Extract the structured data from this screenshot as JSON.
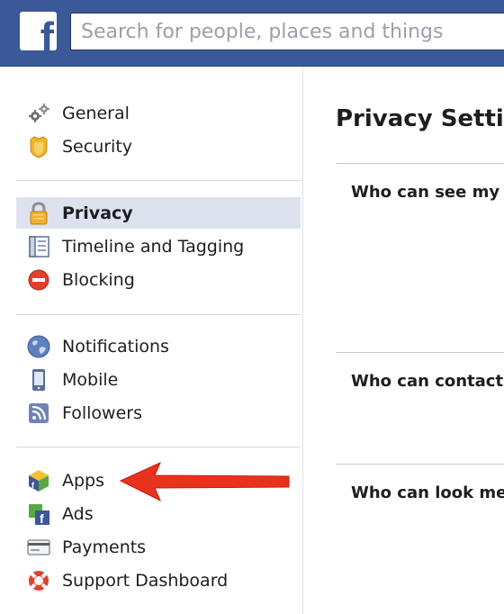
{
  "header": {
    "logo_letter": "f",
    "search_placeholder": "Search for people, places and things"
  },
  "sidebar": {
    "groups": [
      [
        {
          "label": "General",
          "icon": "gears-icon"
        },
        {
          "label": "Security",
          "icon": "security-badge-icon"
        }
      ],
      [
        {
          "label": "Privacy",
          "icon": "lock-icon",
          "active": true
        },
        {
          "label": "Timeline and Tagging",
          "icon": "timeline-icon"
        },
        {
          "label": "Blocking",
          "icon": "blocking-icon"
        }
      ],
      [
        {
          "label": "Notifications",
          "icon": "globe-icon"
        },
        {
          "label": "Mobile",
          "icon": "mobile-phone-icon"
        },
        {
          "label": "Followers",
          "icon": "rss-icon"
        }
      ],
      [
        {
          "label": "Apps",
          "icon": "apps-cube-icon"
        },
        {
          "label": "Ads",
          "icon": "ads-icon"
        },
        {
          "label": "Payments",
          "icon": "credit-card-icon"
        },
        {
          "label": "Support Dashboard",
          "icon": "lifebuoy-icon"
        }
      ]
    ]
  },
  "main": {
    "title": "Privacy Settir",
    "sections": [
      {
        "label": "Who can see my s"
      },
      {
        "label": "Who can contact"
      },
      {
        "label": "Who can look me"
      }
    ]
  },
  "colors": {
    "brand_blue": "#3b5998",
    "active_row": "#dde2ee",
    "arrow_red": "#e8321e"
  }
}
